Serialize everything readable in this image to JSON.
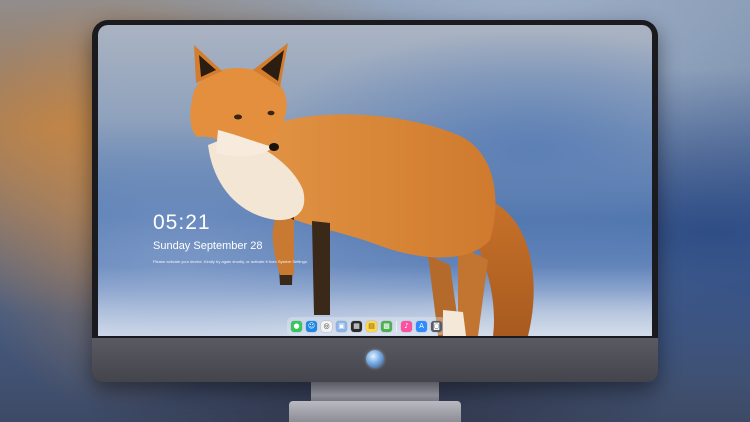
{
  "lock_screen": {
    "time": "05:21",
    "date": "Sunday September  28",
    "notice": "Please activate your device. Kindly try again shortly, or activate it from System Settings."
  },
  "dock": {
    "items": [
      {
        "name": "messages-icon",
        "glyph": "●",
        "color": "#34c759"
      },
      {
        "name": "finder-icon",
        "glyph": "☺",
        "color": "#1e88e5"
      },
      {
        "name": "safari-icon",
        "glyph": "◎",
        "color": "#f2f2f2"
      },
      {
        "name": "preview-icon",
        "glyph": "▣",
        "color": "#8ab4e8"
      },
      {
        "name": "clapper-icon",
        "glyph": "▦",
        "color": "#2b2b2b"
      },
      {
        "name": "notes-icon",
        "glyph": "▤",
        "color": "#ffd54a"
      },
      {
        "name": "photos-icon",
        "glyph": "▩",
        "color": "#4caf50"
      },
      {
        "name": "music-icon",
        "glyph": "♪",
        "color": "#ff4fa0"
      },
      {
        "name": "app-store-icon",
        "glyph": "A",
        "color": "#2f8cff"
      },
      {
        "name": "camera-icon",
        "glyph": "◙",
        "color": "#555a66"
      }
    ]
  },
  "colors": {
    "fox_orange": "#d9822b",
    "fox_cream": "#f3e6d4",
    "sky_blue": "#4d74ad"
  }
}
